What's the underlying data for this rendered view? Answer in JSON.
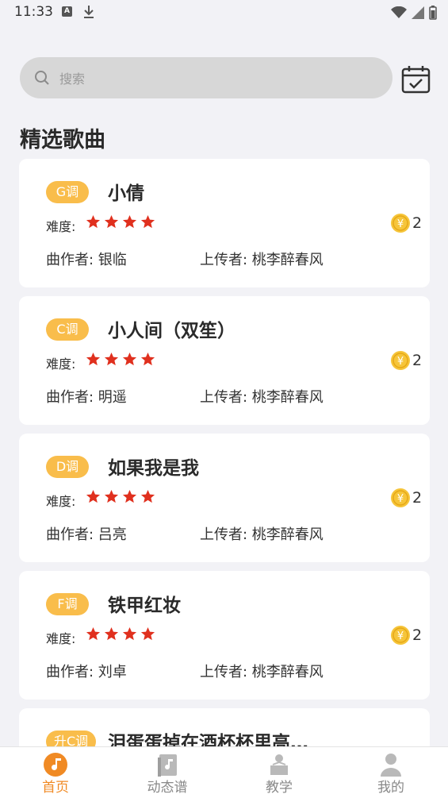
{
  "status_bar": {
    "time": "11:33"
  },
  "search": {
    "placeholder": "搜索"
  },
  "section_title": "精选歌曲",
  "songs": [
    {
      "key": "G调",
      "title": "小倩",
      "difficulty_label": "难度:",
      "stars": 4,
      "coins": "2",
      "composer": "曲作者: 银临",
      "uploader": "上传者: 桃李醉春风"
    },
    {
      "key": "C调",
      "title": "小人间（双笙）",
      "difficulty_label": "难度:",
      "stars": 4,
      "coins": "2",
      "composer": "曲作者: 明遥",
      "uploader": "上传者: 桃李醉春风"
    },
    {
      "key": "D调",
      "title": "如果我是我",
      "difficulty_label": "难度:",
      "stars": 4,
      "coins": "2",
      "composer": "曲作者: 吕亮",
      "uploader": "上传者: 桃李醉春风"
    },
    {
      "key": "F调",
      "title": "铁甲红妆",
      "difficulty_label": "难度:",
      "stars": 4,
      "coins": "2",
      "composer": "曲作者: 刘卓",
      "uploader": "上传者: 桃李醉春风"
    },
    {
      "key": "升C调",
      "title": "泪蛋蛋掉在酒杯杯里高…"
    }
  ],
  "nav": [
    {
      "label": "首页",
      "icon": "music-note-icon",
      "active": true
    },
    {
      "label": "动态谱",
      "icon": "sheet-music-icon",
      "active": false
    },
    {
      "label": "教学",
      "icon": "teacher-icon",
      "active": false
    },
    {
      "label": "我的",
      "icon": "profile-icon",
      "active": false
    }
  ],
  "colors": {
    "accent": "#f08a24",
    "badge": "#f9bd4b",
    "star": "#e0301e",
    "coin": "#f6c53a"
  }
}
